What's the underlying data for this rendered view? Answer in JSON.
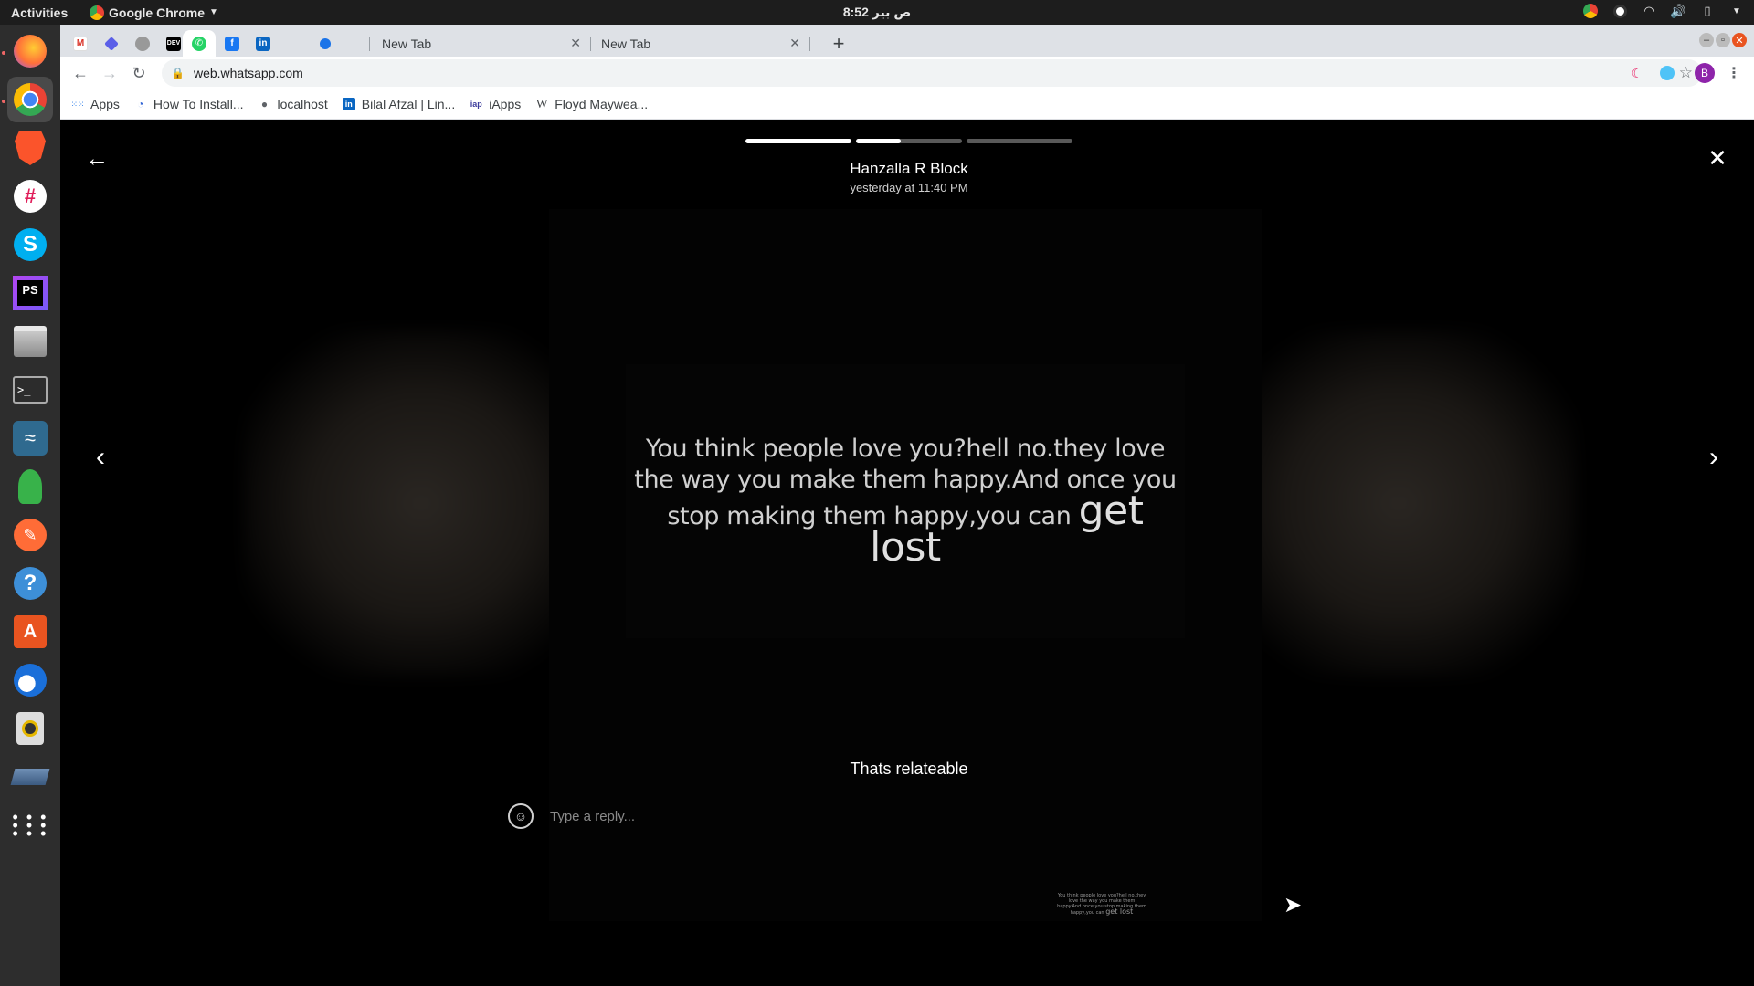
{
  "topbar": {
    "activities": "Activities",
    "app_name": "Google Chrome",
    "clock": "8:52 ص  بير"
  },
  "browser": {
    "tabs": [
      {
        "title": "New Tab"
      },
      {
        "title": "New Tab"
      }
    ],
    "url": "web.whatsapp.com",
    "profile_initial": "B",
    "bookmarks": [
      {
        "label": "Apps"
      },
      {
        "label": "How To Install..."
      },
      {
        "label": "localhost"
      },
      {
        "label": "Bilal Afzal | Lin..."
      },
      {
        "label": "iApps"
      },
      {
        "label": "Floyd Maywea..."
      }
    ]
  },
  "status": {
    "author": "Hanzalla R Block",
    "timestamp": "yesterday at 11:40 PM",
    "progress": [
      1.0,
      0.42,
      0.0
    ],
    "quote_main": "You think people love you?hell no.they love the way you make them happy.And once you stop making them happy,you can",
    "quote_emph": "get lost",
    "caption": "Thats relateable",
    "reply_placeholder": "Type a reply..."
  }
}
